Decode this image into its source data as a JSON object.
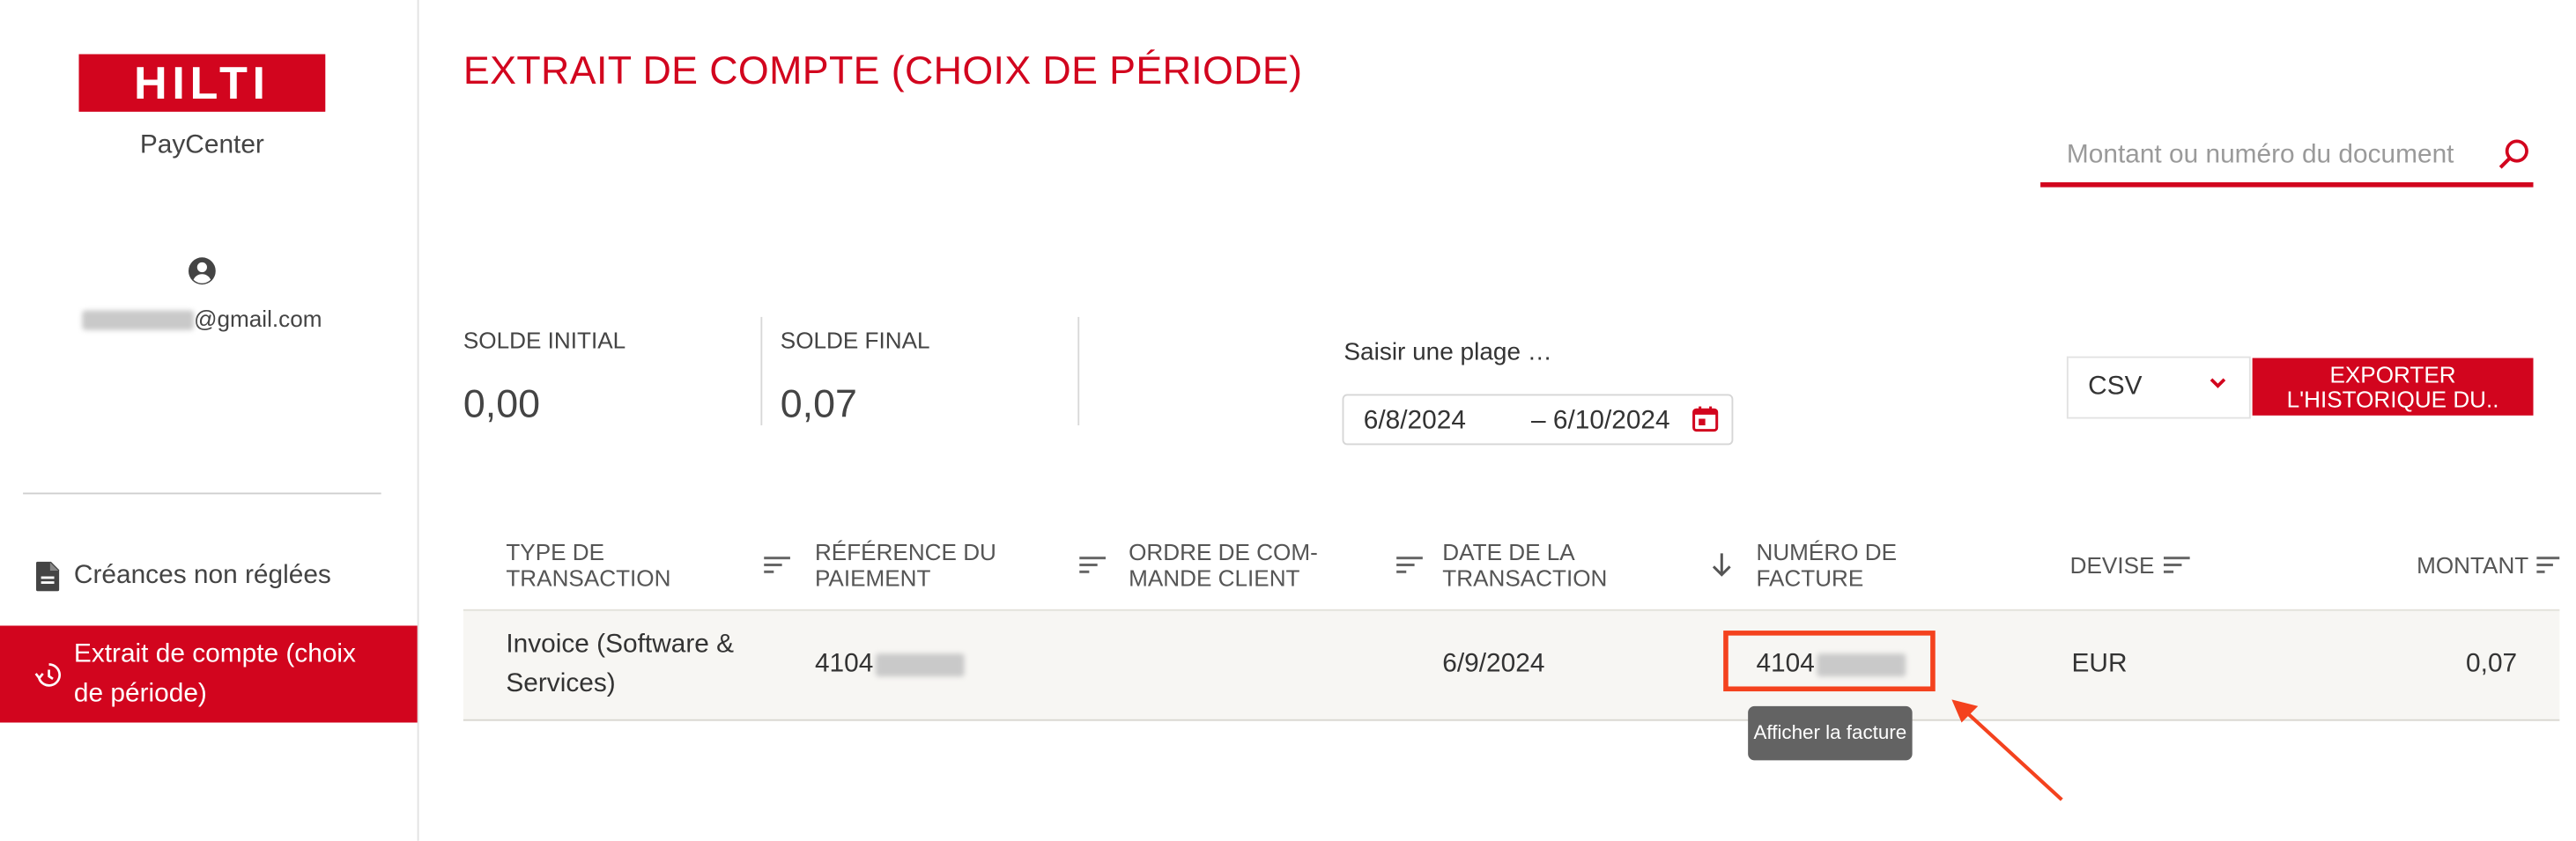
{
  "sidebar": {
    "logo_text": "HILTI",
    "app_name": "PayCenter",
    "user_email_suffix": "@gmail.com",
    "nav_items": [
      {
        "label": "Créances non réglées",
        "icon": "document-icon",
        "active": false
      },
      {
        "label": "Extrait de compte (choix de période)",
        "icon": "history-icon",
        "active": true
      }
    ]
  },
  "main": {
    "title": "EXTRAIT DE COMPTE (CHOIX DE PÉRIODE)",
    "search": {
      "placeholder": "Montant ou numéro du document",
      "value": ""
    },
    "balances": [
      {
        "label": "SOLDE INITIAL",
        "value": "0,00"
      },
      {
        "label": "SOLDE FINAL",
        "value": "0,07"
      }
    ],
    "date_range": {
      "label": "Saisir une plage …",
      "from": "6/8/2024",
      "to": "– 6/10/2024"
    },
    "export": {
      "format_selected": "CSV",
      "button_line1": "EXPORTER",
      "button_line2": "L'HISTORIQUE DU.."
    },
    "table": {
      "columns": [
        {
          "line1": "TYPE DE",
          "line2": "TRANSACTION"
        },
        {
          "line1": "RÉFÉRENCE DU",
          "line2": "PAIEMENT"
        },
        {
          "line1": "ORDRE DE COM-",
          "line2": "MANDE CLIENT"
        },
        {
          "line1": "DATE DE LA",
          "line2": "TRANSACTION"
        },
        {
          "line1": "NUMÉRO DE",
          "line2": "FACTURE"
        },
        {
          "line1": "DEVISE",
          "line2": ""
        },
        {
          "line1": "MONTANT",
          "line2": ""
        }
      ],
      "rows": [
        {
          "type_line1": "Invoice (Software &",
          "type_line2": "Services)",
          "payment_ref": "4104",
          "customer_order": "",
          "date": "6/9/2024",
          "invoice_number": "4104",
          "currency": "EUR",
          "amount": "0,07"
        }
      ]
    },
    "tooltip": "Afficher la facture"
  },
  "colors": {
    "brand": "#d2051e",
    "annotation": "#f4421e"
  }
}
